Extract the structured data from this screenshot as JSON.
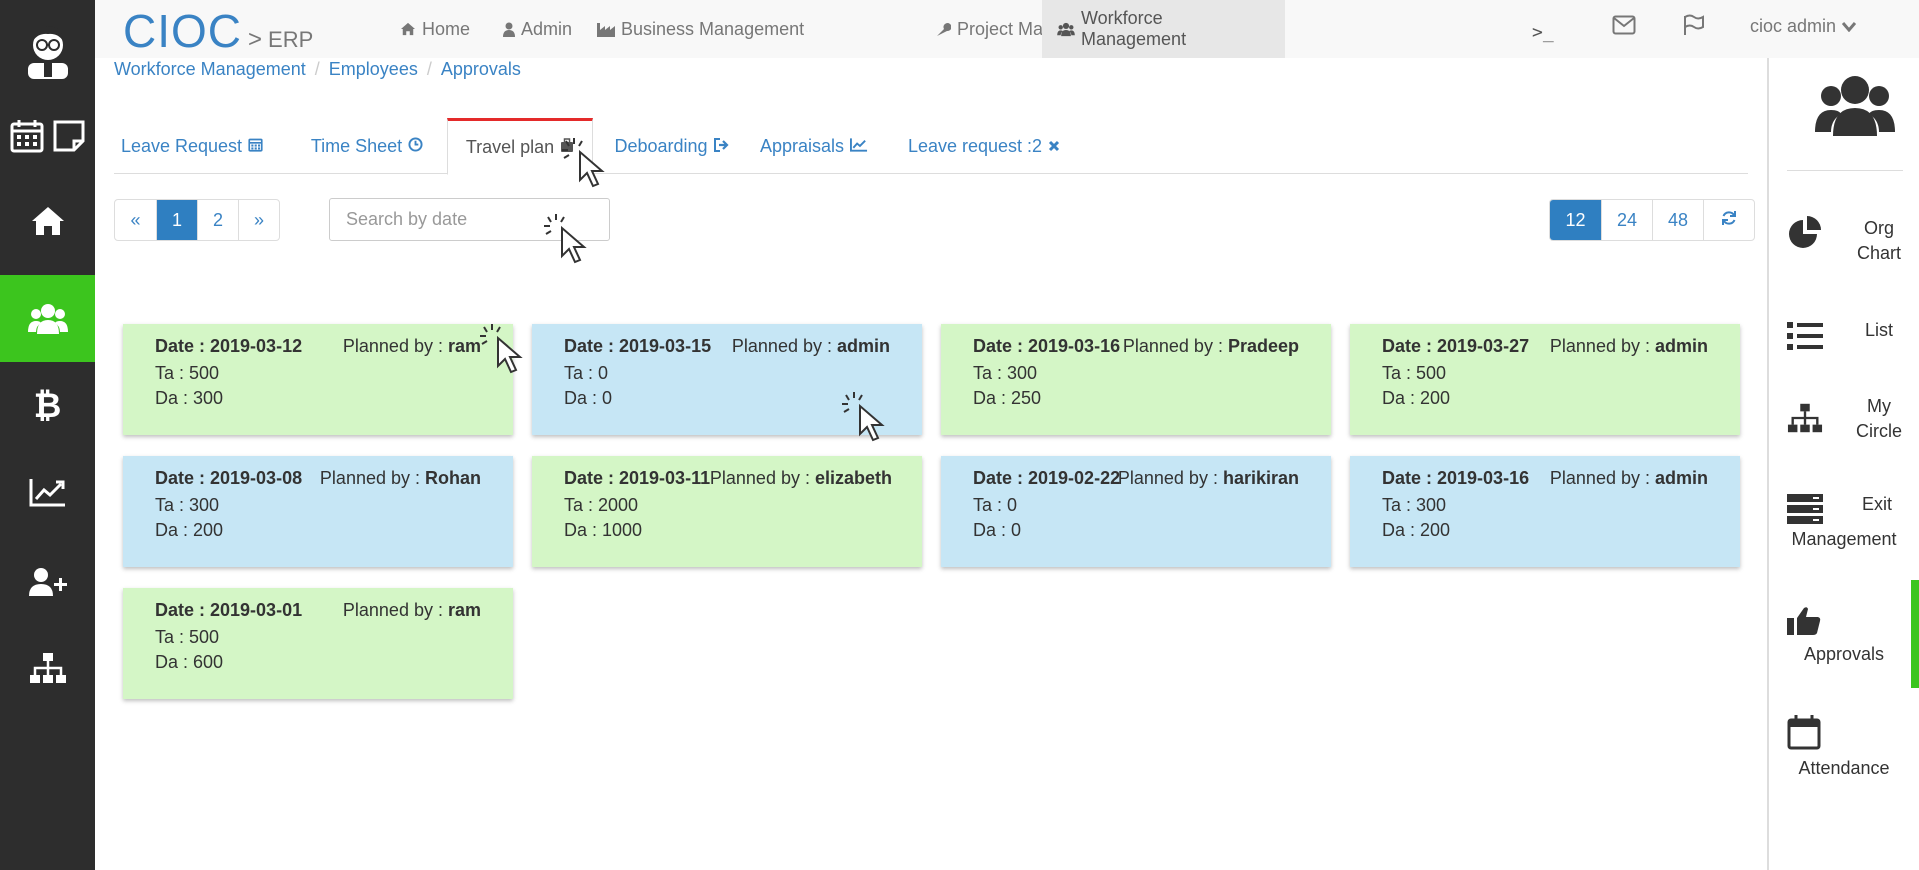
{
  "brand": {
    "name": "CIOC",
    "sep": ">",
    "sub": "ERP"
  },
  "nav": {
    "items": [
      {
        "label": "Home",
        "icon": "home-icon"
      },
      {
        "label": "Admin",
        "icon": "user-icon"
      },
      {
        "label": "Business Management",
        "icon": "industry-icon"
      },
      {
        "label": "Project Management",
        "icon": "wrench-icon"
      },
      {
        "label": "Workforce Management",
        "icon": "users-icon"
      }
    ],
    "terminal_icon": "terminal-icon",
    "mail_icon": "envelope-icon",
    "flag_icon": "flag-icon",
    "user": "cioc admin"
  },
  "breadcrumb": [
    "Workforce Management",
    "Employees",
    "Approvals"
  ],
  "tabs": [
    {
      "label": "Leave Request",
      "icon": "calendar-icon"
    },
    {
      "label": "Time Sheet",
      "icon": "clock-icon"
    },
    {
      "label": "Travel plan",
      "icon": "suitcase-icon"
    },
    {
      "label": "Deboarding",
      "icon": "sign-out-icon"
    },
    {
      "label": "Appraisals",
      "icon": "line-chart-icon"
    },
    {
      "label": "Leave request :2",
      "icon": "times-icon"
    }
  ],
  "pager": {
    "prev": "«",
    "pages": [
      "1",
      "2"
    ],
    "next": "»",
    "current": "1"
  },
  "search": {
    "placeholder": "Search by date"
  },
  "per_page": {
    "options": [
      "12",
      "24",
      "48"
    ],
    "current": "12"
  },
  "cards": [
    {
      "date": "Date : 2019-03-12",
      "planned_label": "Planned by : ",
      "planned_by": "ram",
      "ta": "Ta : 500",
      "da": "Da : 300",
      "color": "green"
    },
    {
      "date": "Date : 2019-03-15",
      "planned_label": "Planned by : ",
      "planned_by": "admin",
      "ta": "Ta : 0",
      "da": "Da : 0",
      "color": "blue"
    },
    {
      "date": "Date : 2019-03-16",
      "planned_label": "Planned by : ",
      "planned_by": "Pradeep",
      "ta": "Ta : 300",
      "da": "Da : 250",
      "color": "green"
    },
    {
      "date": "Date : 2019-03-27",
      "planned_label": "Planned by : ",
      "planned_by": "admin",
      "ta": "Ta : 500",
      "da": "Da : 200",
      "color": "green"
    },
    {
      "date": "Date : 2019-03-08",
      "planned_label": "Planned by : ",
      "planned_by": "Rohan",
      "ta": "Ta : 300",
      "da": "Da : 200",
      "color": "blue"
    },
    {
      "date": "Date : 2019-03-11",
      "planned_label": "Planned by : ",
      "planned_by": "elizabeth",
      "ta": "Ta : 2000",
      "da": "Da : 1000",
      "color": "green"
    },
    {
      "date": "Date : 2019-02-22",
      "planned_label": "Planned by : ",
      "planned_by": "harikiran",
      "ta": "Ta : 0",
      "da": "Da : 0",
      "color": "blue"
    },
    {
      "date": "Date : 2019-03-16",
      "planned_label": "Planned by : ",
      "planned_by": "admin",
      "ta": "Ta : 300",
      "da": "Da : 200",
      "color": "blue"
    },
    {
      "date": "Date : 2019-03-01",
      "planned_label": "Planned by : ",
      "planned_by": "ram",
      "ta": "Ta : 500",
      "da": "Da : 600",
      "color": "green"
    }
  ],
  "right_sidebar": {
    "header_icon": "users-icon",
    "items": [
      {
        "label_1": "Org",
        "label_2": "Chart",
        "icon": "pie-chart-icon"
      },
      {
        "label_1": "List",
        "label_2": "",
        "icon": "list-icon"
      },
      {
        "label_1": "My",
        "label_2": "Circle",
        "icon": "sitemap-icon"
      },
      {
        "label_1": "Exit",
        "label_2": "Management",
        "icon": "server-icon"
      },
      {
        "label_1": "Approvals",
        "label_2": "",
        "icon": "thumbs-up-icon"
      },
      {
        "label_1": "Attendance",
        "label_2": "",
        "icon": "calendar-icon"
      }
    ]
  },
  "left_sidebar": {
    "items": [
      "avatar",
      "calendar-icon",
      "note-icon",
      "home-icon",
      "users-icon",
      "bitcoin-icon",
      "line-chart-icon",
      "user-plus-icon",
      "sitemap-icon"
    ]
  },
  "colors": {
    "brand": "#3a83c4",
    "active_green": "#3cc51e",
    "card_green": "#d4f6c6",
    "card_blue": "#c6e6f5",
    "tab_accent": "#e42a2a"
  }
}
